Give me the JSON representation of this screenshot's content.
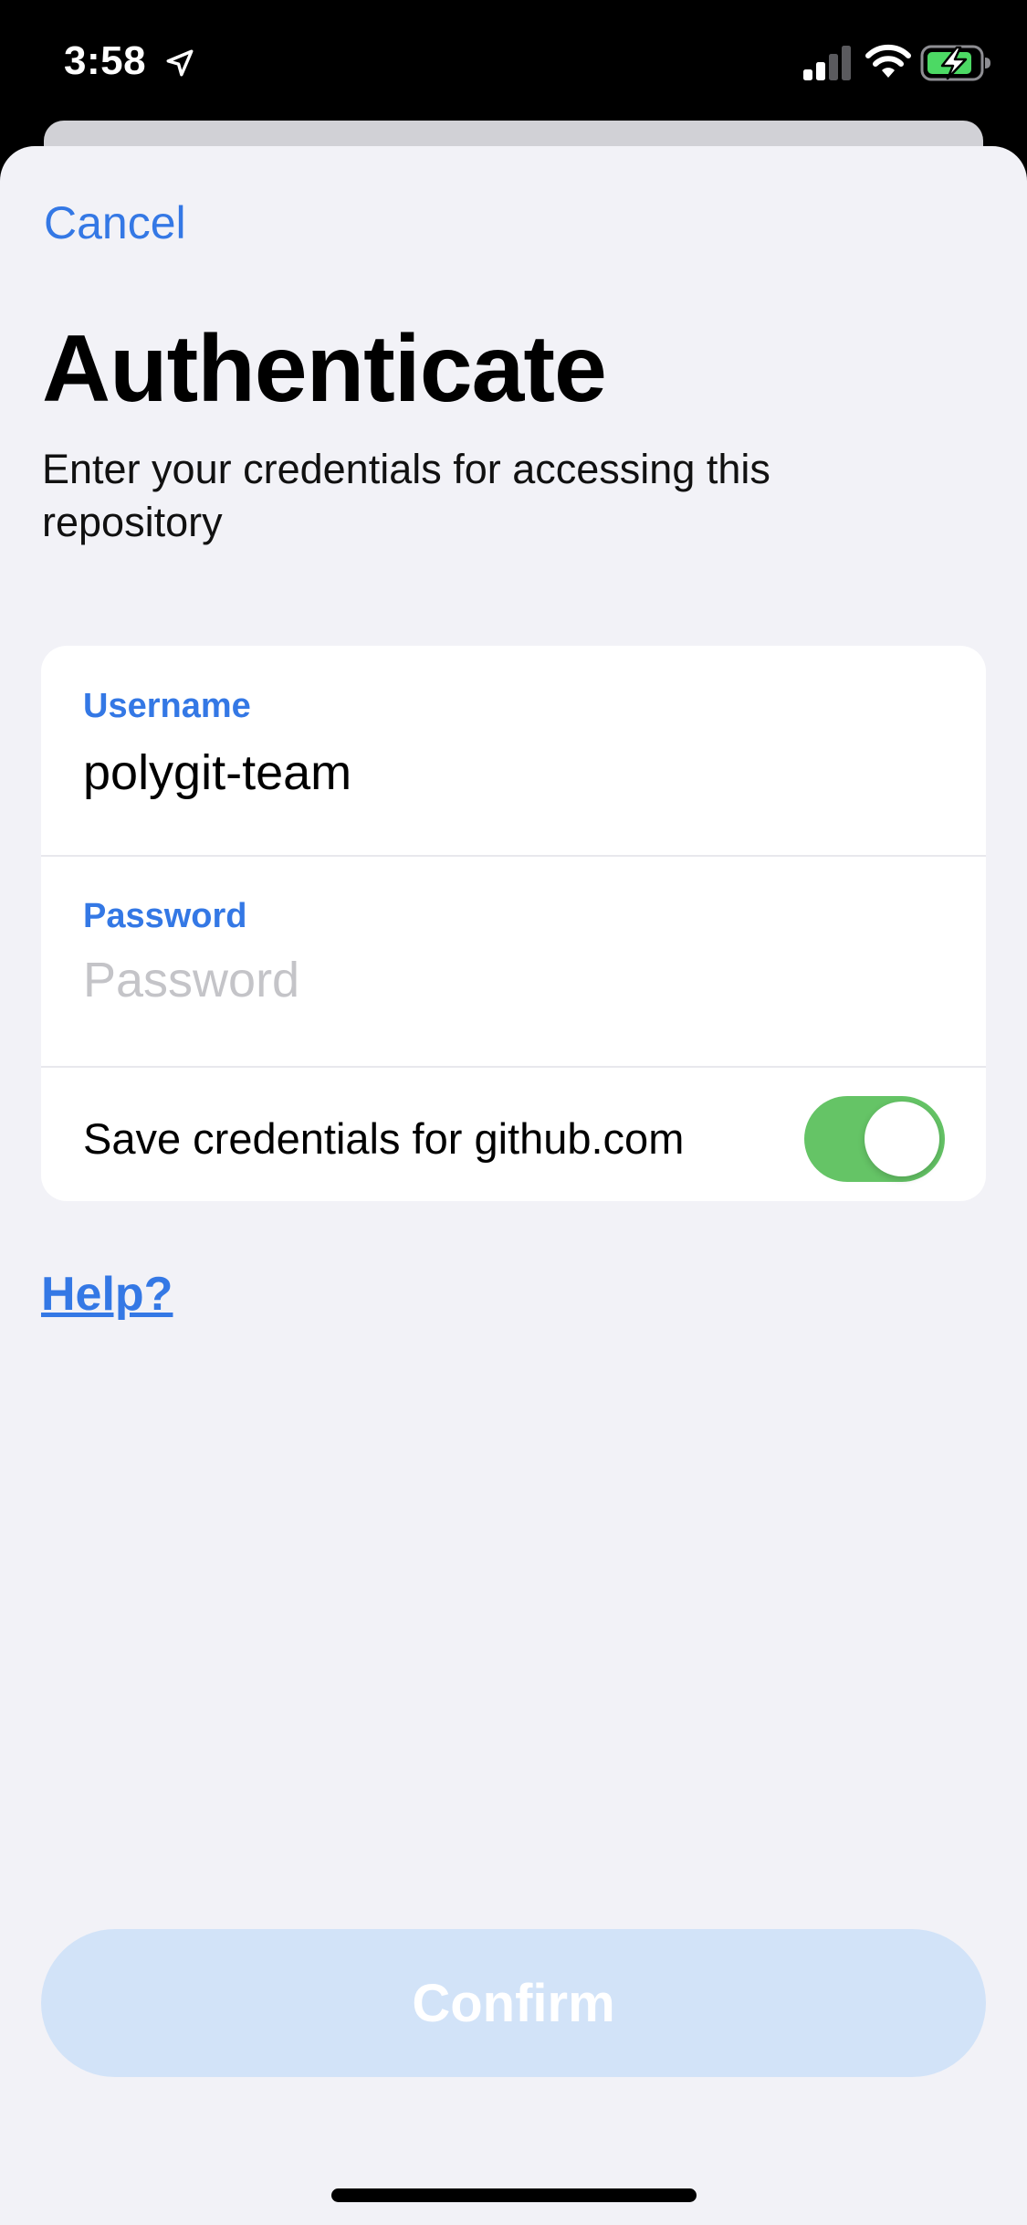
{
  "status_bar": {
    "time": "3:58",
    "icons": [
      "location-arrow-icon",
      "cellular-signal-icon",
      "wifi-icon",
      "battery-charging-icon"
    ],
    "battery_color": "#4cd964"
  },
  "header": {
    "cancel_label": "Cancel"
  },
  "main": {
    "title": "Authenticate",
    "subtitle": "Enter your credentials for accessing this repository"
  },
  "form": {
    "username": {
      "label": "Username",
      "value": "polygit-team"
    },
    "password": {
      "label": "Password",
      "value": "",
      "placeholder": "Password"
    },
    "save_credentials": {
      "label": "Save credentials for github.com",
      "enabled": true
    }
  },
  "help_label": "Help?",
  "confirm_label": "Confirm",
  "colors": {
    "accent": "#3478e5",
    "background": "#f2f2f7",
    "toggle_on": "#65c466",
    "confirm_disabled_bg": "#d2e3f8"
  }
}
